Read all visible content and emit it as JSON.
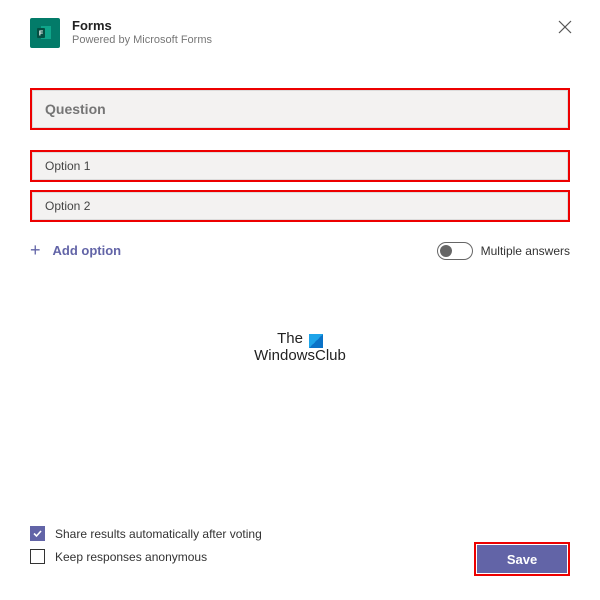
{
  "header": {
    "app_name": "Forms",
    "subtitle": "Powered by Microsoft Forms"
  },
  "form": {
    "question_placeholder": "Question",
    "options": [
      {
        "label": "Option 1"
      },
      {
        "label": "Option 2"
      }
    ],
    "add_option_label": "Add option",
    "multiple_answers_label": "Multiple answers",
    "multiple_answers_on": false
  },
  "checkboxes": {
    "share_results": {
      "label": "Share results automatically after voting",
      "checked": true
    },
    "anonymous": {
      "label": "Keep responses anonymous",
      "checked": false
    }
  },
  "actions": {
    "save_label": "Save"
  },
  "watermark": {
    "line1": "The",
    "line2": "WindowsClub"
  },
  "colors": {
    "accent": "#6264A7",
    "highlight_border": "#ED0000",
    "forms_icon": "#037B69"
  }
}
